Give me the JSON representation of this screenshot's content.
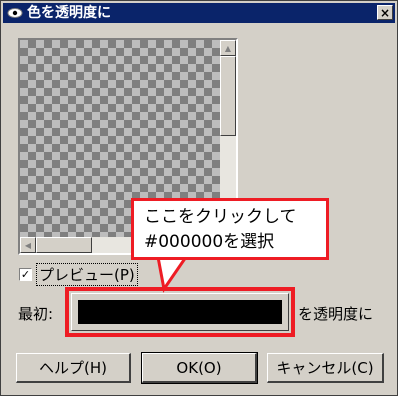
{
  "window": {
    "title": "色を透明度に",
    "close_label": "×"
  },
  "preview": {
    "checkbox_checked": true,
    "checkbox_mark": "✓",
    "label": "プレビュー(P)"
  },
  "color_row": {
    "left_label": "最初:",
    "right_label": "を透明度に",
    "color": "#000000"
  },
  "callout": {
    "line1": "ここをクリックして",
    "line2": "#000000を選択",
    "border_color": "#ee1c24"
  },
  "buttons": {
    "help": "ヘルプ(H)",
    "ok": "OK(O)",
    "cancel": "キャンセル(C)"
  },
  "icons": {
    "title": "gimp-eye-icon",
    "scroll_up": "▲",
    "scroll_left": "◀"
  }
}
